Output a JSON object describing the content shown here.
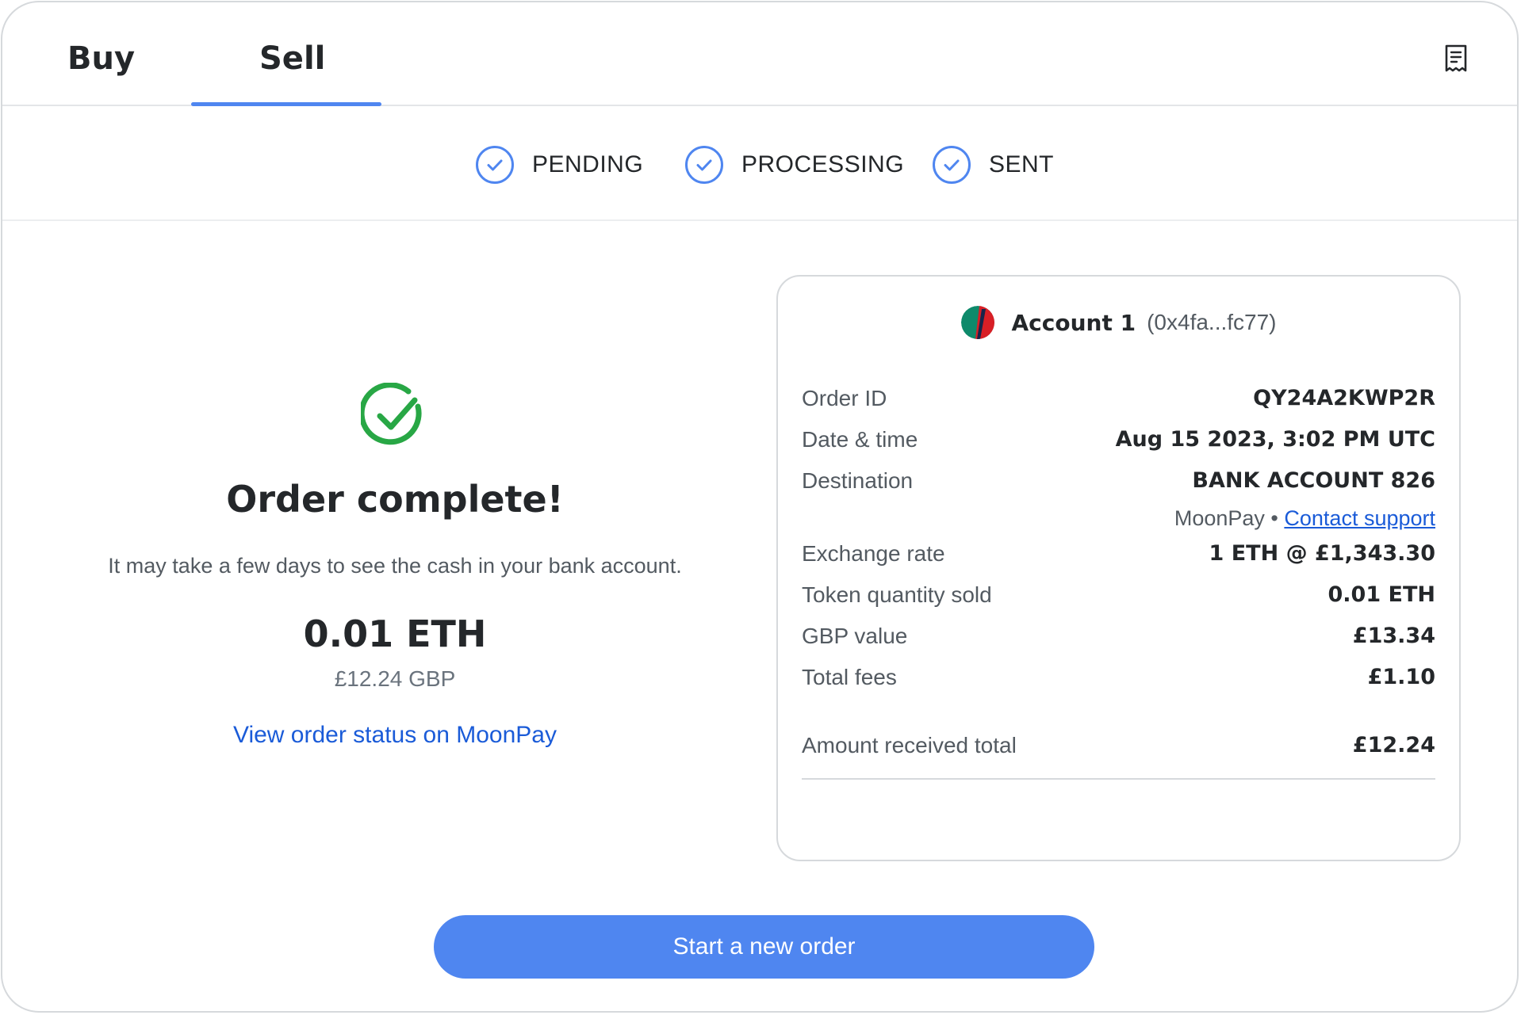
{
  "tabs": {
    "buy_label": "Buy",
    "sell_label": "Sell",
    "active": "Sell"
  },
  "header": {
    "activity_icon": "receipt-icon"
  },
  "steps": [
    {
      "label": "PENDING",
      "icon": "check-circle-icon",
      "done": true
    },
    {
      "label": "PROCESSING",
      "icon": "check-circle-icon",
      "done": true
    },
    {
      "label": "SENT",
      "icon": "check-circle-icon",
      "done": true
    }
  ],
  "summary": {
    "icon": "success-check-icon",
    "title": "Order complete!",
    "subtitle": "It may take a few days to see the cash in your bank account.",
    "crypto_amount": "0.01 ETH",
    "fiat_amount": "£12.24 GBP",
    "status_link": "View order status on MoonPay"
  },
  "details": {
    "account_name": "Account 1",
    "account_address": "(0x4fa...fc77)",
    "rows": {
      "order_id": {
        "label": "Order ID",
        "value": "QY24A2KWP2R"
      },
      "date_time": {
        "label": "Date & time",
        "value": "Aug 15 2023, 3:02 PM UTC"
      },
      "destination": {
        "label": "Destination",
        "value": "BANK ACCOUNT 826"
      },
      "exchange_rate": {
        "label": "Exchange rate",
        "value": "1 ETH @ £1,343.30"
      },
      "token_qty": {
        "label": "Token quantity sold",
        "value": "0.01 ETH"
      },
      "gbp_value": {
        "label": "GBP value",
        "value": "£13.34"
      },
      "total_fees": {
        "label": "Total fees",
        "value": "£1.10"
      },
      "amount_received": {
        "label": "Amount received total",
        "value": "£12.24"
      }
    },
    "provider": "MoonPay",
    "separator": "•",
    "contact_support": "Contact support"
  },
  "cta": {
    "label": "Start a new order"
  },
  "colors": {
    "accent": "#4f86f0",
    "success": "#28a745",
    "link": "#1a5bd8",
    "text": "#24272a",
    "muted": "#535a61"
  }
}
